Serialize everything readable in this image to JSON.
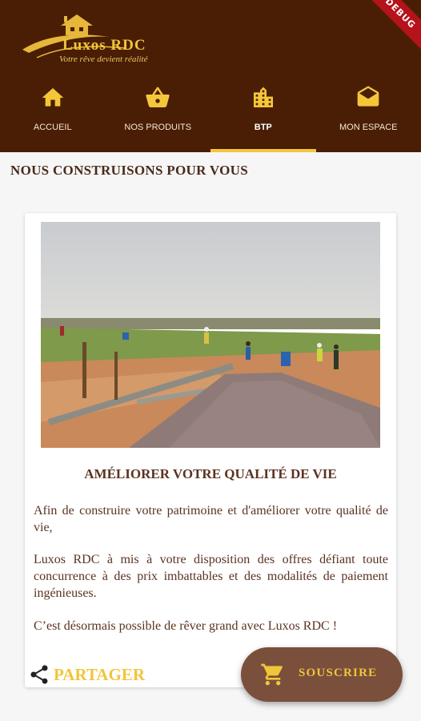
{
  "app": {
    "logo_name": "Luxos RDC",
    "logo_tagline": "Votre rêve devient réalité",
    "debug_banner": "DEBUG"
  },
  "nav": {
    "items": [
      {
        "label": "ACCUEIL",
        "icon": "home-icon"
      },
      {
        "label": "NOS PRODUITS",
        "icon": "basket-icon"
      },
      {
        "label": "BTP",
        "icon": "buildings-icon"
      },
      {
        "label": "MON ESPACE",
        "icon": "envelope-icon"
      }
    ],
    "active_index": 2
  },
  "page": {
    "section_title": "NOUS CONSTRUISONS POUR VOUS"
  },
  "card": {
    "image_alt": "construction site",
    "heading": "AMÉLIORER VOTRE QUALITÉ DE VIE",
    "paragraphs": [
      "Afin de construire votre patrimoine et d'améliorer votre qualité de vie,",
      "Luxos RDC à mis à votre disposition des offres défiant toute concurrence à des prix imbattables et des modalités de paiement ingénieuses.",
      "C’est désormais possible de rêver grand avec Luxos RDC !"
    ],
    "share_label": "PARTAGER"
  },
  "fab": {
    "label": "SOUSCRIRE",
    "icon": "cart-icon"
  },
  "colors": {
    "header_bg": "#4a1e04",
    "accent_gold": "#f0c53a",
    "fab_bg": "#7a4f3c",
    "text_brown": "#5a3320"
  }
}
